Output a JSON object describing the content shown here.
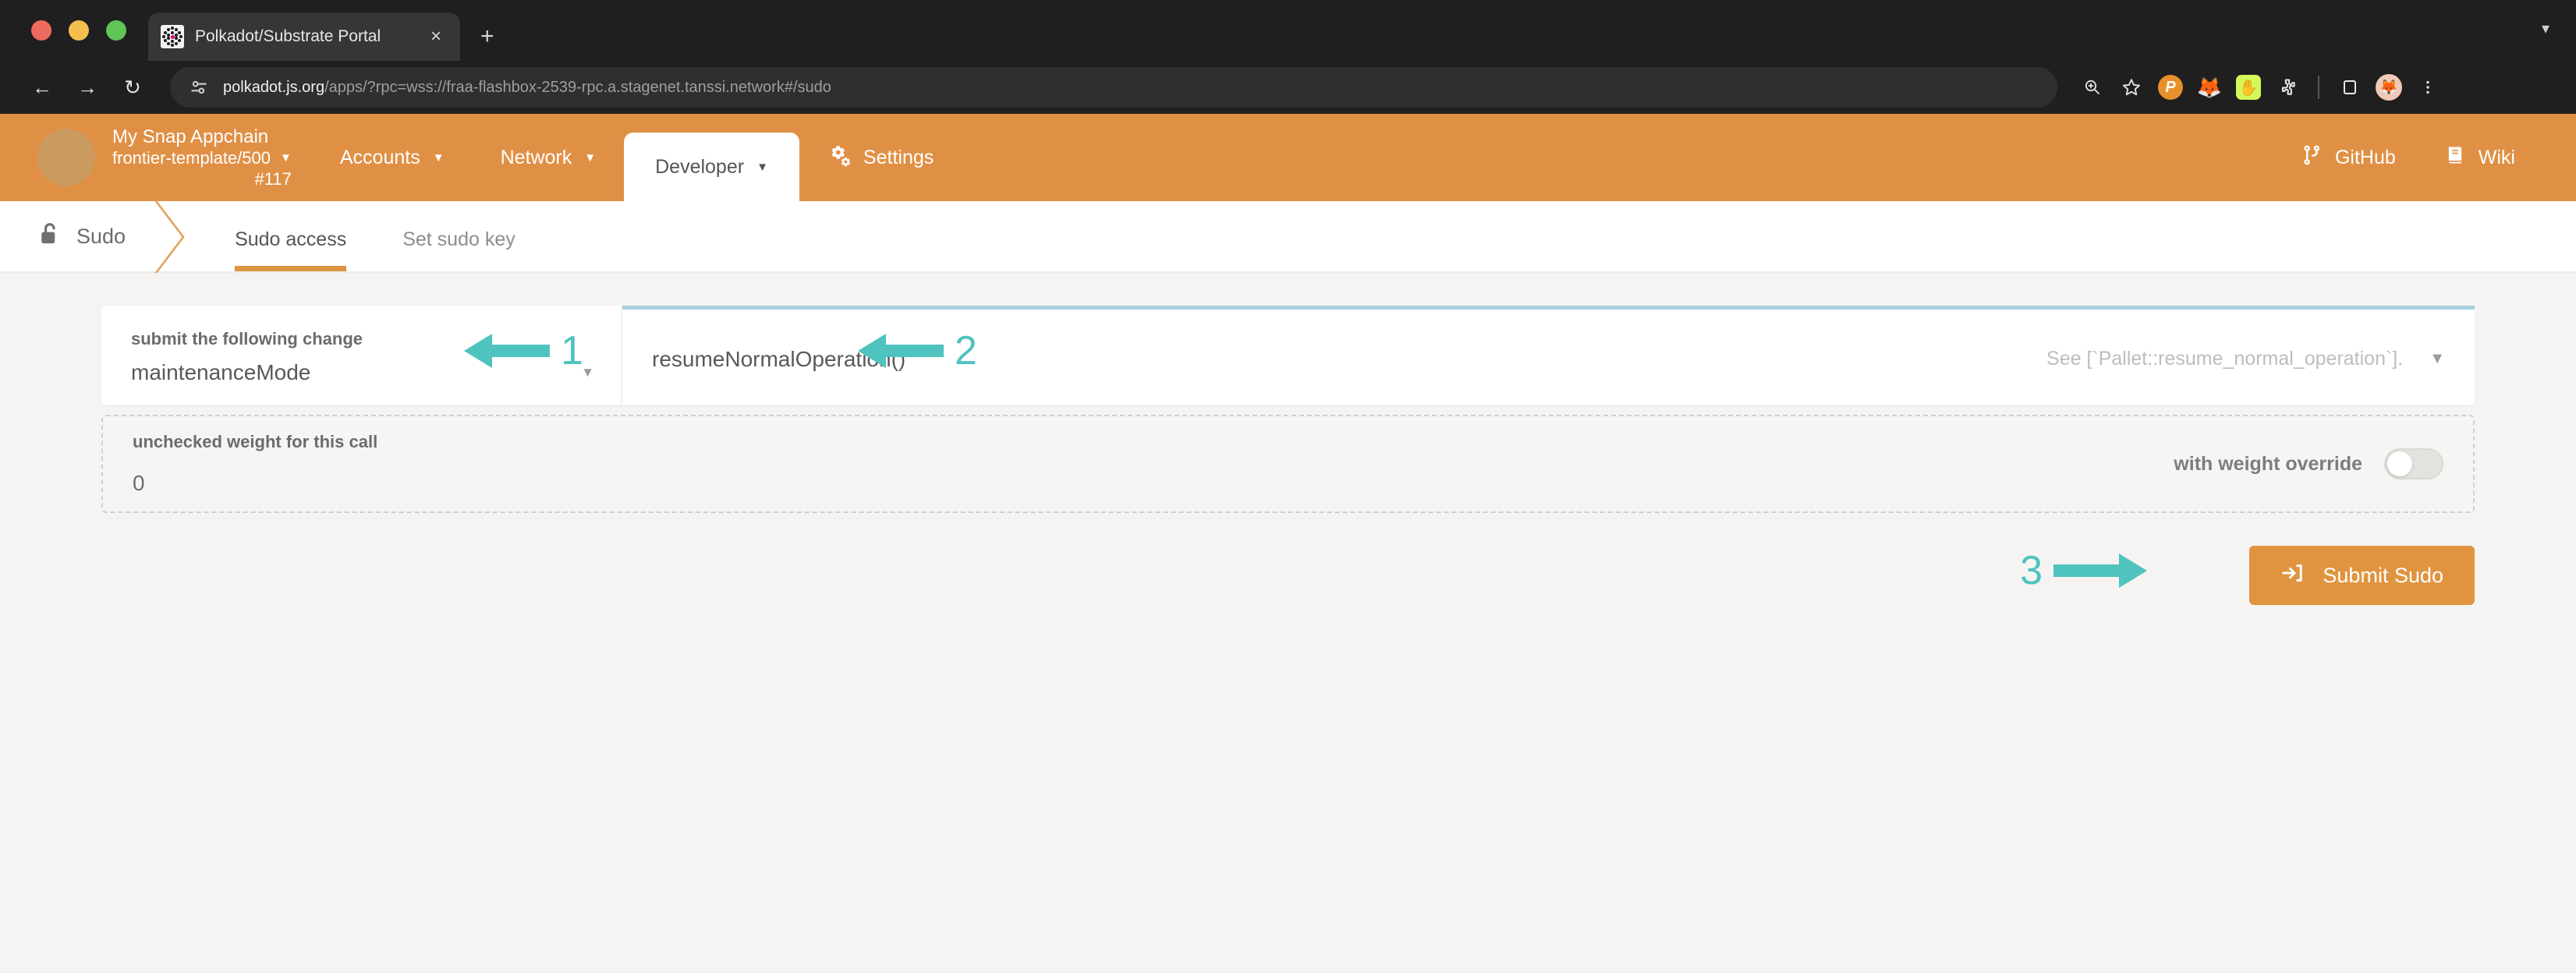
{
  "browser": {
    "tab": {
      "title": "Polkadot/Substrate Portal",
      "favicon": "polkadot-dots-icon",
      "close": "×"
    },
    "new_tab": "+",
    "window_controls": [
      "close-red",
      "minimize-yellow",
      "maximize-green"
    ],
    "nav": {
      "back": "←",
      "forward": "→",
      "reload": "↻"
    },
    "omnibox": {
      "site_icon": "page-settings-icon",
      "url_host": "polkadot.js.org",
      "url_path": "/apps/?rpc=wss://fraa-flashbox-2539-rpc.a.stagenet.tanssi.network#/sudo"
    },
    "toolbar_icons": [
      {
        "name": "zoom-search-icon",
        "glyph": "⌕"
      },
      {
        "name": "bookmark-star-icon",
        "glyph": "☆"
      },
      {
        "name": "polkadot-extension-icon",
        "glyph": "P"
      },
      {
        "name": "metamask-extension-icon",
        "glyph": "🦊"
      },
      {
        "name": "talisman-extension-icon",
        "glyph": "✋"
      },
      {
        "name": "extensions-puzzle-icon",
        "glyph": "⬡"
      },
      {
        "name": "side-panel-icon",
        "glyph": "▭"
      },
      {
        "name": "profile-avatar-icon",
        "glyph": "🦊"
      },
      {
        "name": "browser-menu-icon",
        "glyph": "⋮"
      }
    ]
  },
  "appbar": {
    "chain": {
      "name": "My Snap Appchain",
      "spec": "frontier-template/500",
      "block": "#117",
      "caret": "▼"
    },
    "items": [
      {
        "label": "Accounts",
        "caret": "▼",
        "active": false
      },
      {
        "label": "Network",
        "caret": "▼",
        "active": false
      },
      {
        "label": "Developer",
        "caret": "▼",
        "active": true
      }
    ],
    "settings": {
      "label": "Settings",
      "icon": "gears-icon"
    },
    "right_links": [
      {
        "label": "GitHub",
        "icon": "code-branch-icon"
      },
      {
        "label": "Wiki",
        "icon": "book-icon"
      }
    ]
  },
  "page": {
    "title": "Sudo",
    "title_icon": "unlock-padlock-icon",
    "tabs": [
      {
        "label": "Sudo access",
        "active": true
      },
      {
        "label": "Set sudo key",
        "active": false
      }
    ]
  },
  "form": {
    "pallet": {
      "label": "submit the following change",
      "value": "maintenanceMode",
      "caret": "▼"
    },
    "call": {
      "value": "resumeNormalOperation()",
      "hint": "See [`Pallet::resume_normal_operation`].",
      "caret": "▼"
    },
    "weight": {
      "label": "unchecked weight for this call",
      "value": "0",
      "toggle_label": "with weight override",
      "toggle_state": "off"
    },
    "submit": {
      "label": "Submit Sudo",
      "icon": "sign-in-arrow-icon"
    }
  },
  "annotations": [
    {
      "number": "1",
      "direction": "left",
      "target": "pallet-dropdown"
    },
    {
      "number": "2",
      "direction": "left",
      "target": "call-dropdown"
    },
    {
      "number": "3",
      "direction": "right",
      "target": "submit-sudo-button"
    }
  ],
  "colors": {
    "brand_orange": "#e09045",
    "button_orange": "#e0943f",
    "annotation_teal": "#4fc3bd",
    "page_bg": "#f5f4f2",
    "chrome_bg": "#1f1f1f"
  }
}
